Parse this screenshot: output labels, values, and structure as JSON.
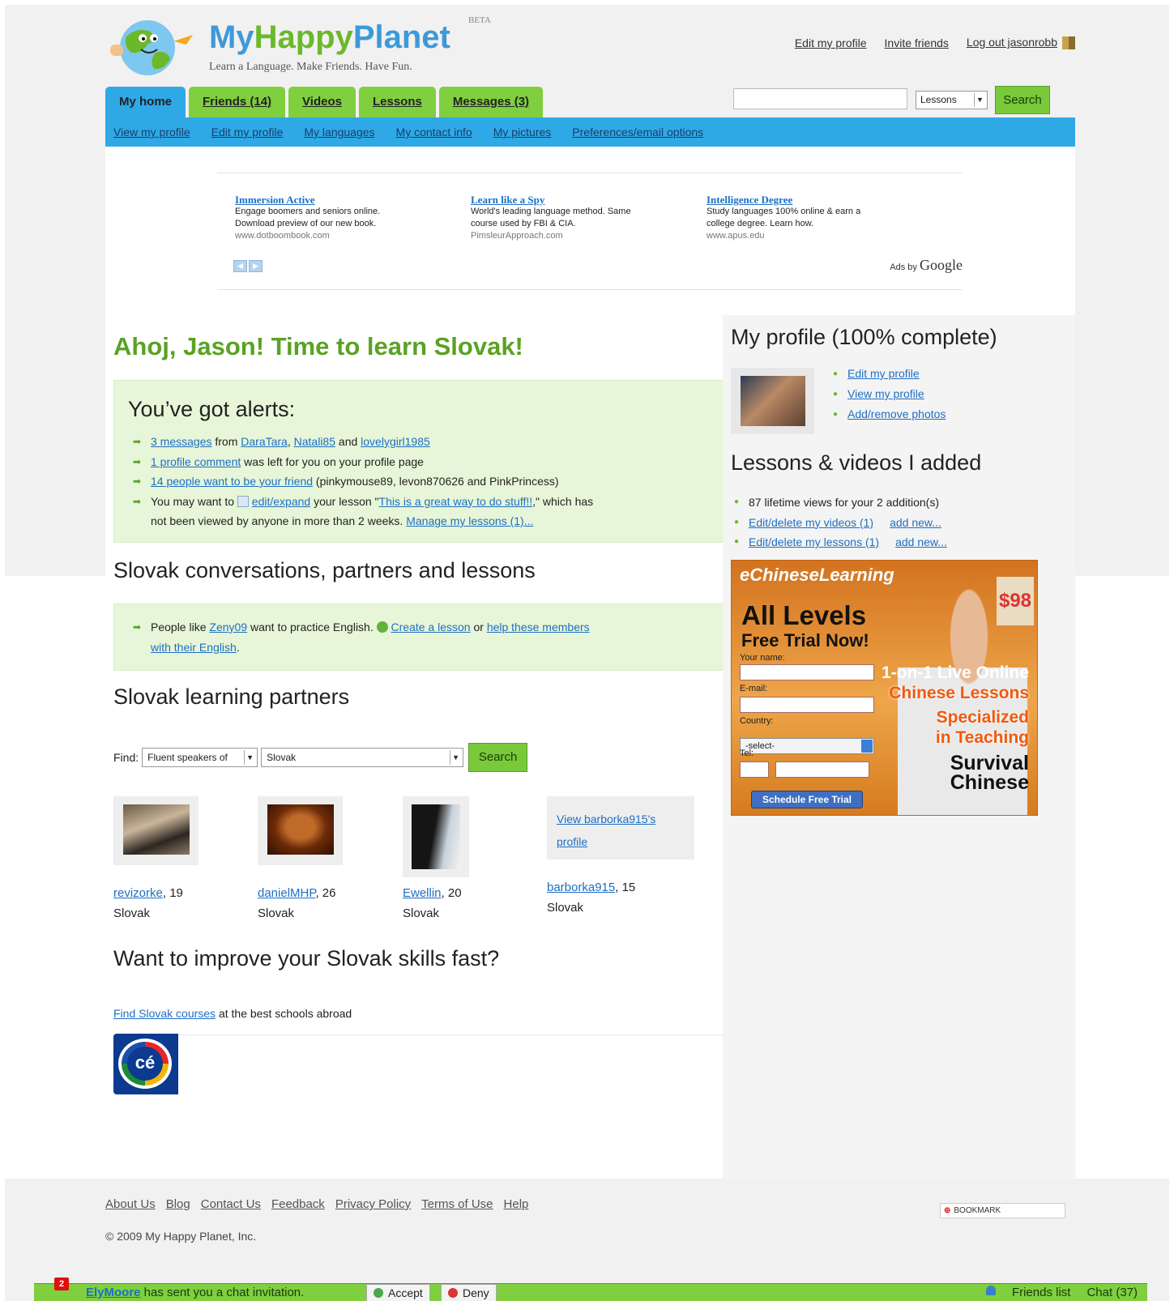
{
  "header": {
    "brand_my": "My",
    "brand_happy": "Happy",
    "brand_planet": "Planet",
    "beta": "BETA",
    "tagline": "Learn a Language. Make Friends. Have Fun.",
    "links": [
      "Edit my profile",
      "Invite friends",
      "Log out jasonrobb"
    ]
  },
  "tabs": [
    {
      "label": "My home",
      "active": true
    },
    {
      "label": "Friends (14)"
    },
    {
      "label": "Videos"
    },
    {
      "label": "Lessons"
    },
    {
      "label": "Messages (3)"
    }
  ],
  "search": {
    "value": "",
    "select": "Lessons",
    "button": "Search"
  },
  "subnav": [
    "View my profile",
    "Edit my profile",
    "My languages",
    "My contact info",
    "My pictures",
    "Preferences/email options"
  ],
  "ads": [
    {
      "title": "Immersion Active",
      "l1": "Engage boomers and seniors online.",
      "l2": "Download preview of our new book.",
      "url": "www.dotboombook.com"
    },
    {
      "title": "Learn like a Spy",
      "l1": "World's leading language method. Same",
      "l2": "course used by FBI & CIA.",
      "url": "PimsleurApproach.com"
    },
    {
      "title": "Intelligence Degree",
      "l1": "Study languages 100% online & earn a",
      "l2": "college degree. Learn how.",
      "url": "www.apus.edu"
    }
  ],
  "ads_by": "Ads by",
  "ads_by_google": "Google",
  "greeting": "Ahoj, Jason! Time to learn Slovak!",
  "alerts": {
    "title": "You’ve got alerts:",
    "a1_link": "3 messages",
    "a1_from": " from ",
    "a1_u1": "DaraTara",
    "a1_c": ", ",
    "a1_u2": "Natali85",
    "a1_and": " and ",
    "a1_u3": "lovelygirl1985",
    "a2_link": "1 profile comment",
    "a2_text": " was left for you on your profile page",
    "a3_link": "14 people want to be your friend",
    "a3_text": " (pinkymouse89, levon870626 and PinkPrincess)",
    "a4_pre": "You may want to ",
    "a4_link": "edit/expand",
    "a4_mid": " your lesson \"",
    "a4_lesson": "This is a great way to do stuff!!",
    "a4_post": ",\" which has",
    "a4_line2": "not been viewed by anyone in more than 2 weeks. ",
    "a4_manage": "Manage my lessons (1)..."
  },
  "convo": {
    "title": "Slovak conversations, partners and lessons",
    "pre": "People like ",
    "user": "Zeny09",
    "mid": " want to practice English. ",
    "create": "Create a lesson",
    "or": " or ",
    "help1": "help these members",
    "help2": "with their English",
    "end": "."
  },
  "partners": {
    "title": "Slovak learning partners",
    "find_label": "Find:",
    "find_type": "Fluent speakers of",
    "find_lang": "Slovak",
    "find_button": "Search",
    "list": [
      {
        "name": "revizorke",
        "age": ", 19",
        "lang": "Slovak"
      },
      {
        "name": "danielMHP",
        "age": ", 26",
        "lang": "Slovak"
      },
      {
        "name": "Ewellin",
        "age": ", 20",
        "lang": "Slovak"
      },
      {
        "name": "barborka915",
        "age": ", 15",
        "lang": "Slovak",
        "view": "View barborka915's profile"
      }
    ]
  },
  "improve": {
    "title": "Want to improve your Slovak skills fast?",
    "link": "Find Slovak courses",
    "text": " at the best schools abroad",
    "logo": "cé"
  },
  "profile": {
    "title": "My profile (100% complete)",
    "links": [
      "Edit my profile",
      "View my profile",
      "Add/remove photos"
    ]
  },
  "lessons": {
    "title": "Lessons & videos I added",
    "views": "87 lifetime views for your 2 addition(s)",
    "videos": "Edit/delete my videos (1)",
    "lessons": "Edit/delete my lessons (1)",
    "add": "add new..."
  },
  "bigad": {
    "brand": "eChineseLearning",
    "big1": "All Levels",
    "big2": "Free Trial Now!",
    "name": "Your name:",
    "email": "E-mail:",
    "country": "Country:",
    "select": "-select-",
    "tel": "Tel:",
    "button": "Schedule Free Trial",
    "p1": "1-on-1 Live Online",
    "p2": "Chinese Lessons",
    "p3": "Specialized",
    "p4": "in Teaching",
    "p5a": "Survival",
    "p5b": "Chinese",
    "price": "$98"
  },
  "footer": {
    "links": [
      "About Us",
      "Blog",
      "Contact Us",
      "Feedback",
      "Privacy Policy",
      "Terms of Use",
      "Help"
    ],
    "copyright": "© 2009 My Happy Planet, Inc.",
    "bookmark": "BOOKMARK"
  },
  "chat": {
    "badge": "2",
    "user": "ElyMoore",
    "text": " has sent you a chat invitation.",
    "accept": "Accept",
    "deny": "Deny",
    "friends": "Friends list",
    "count": "Chat (37)"
  },
  "colors": {
    "green": "#6cb82b",
    "blue": "#2fa9e6",
    "link": "#1d6fc4",
    "alert_bg": "#e7f6d8"
  }
}
